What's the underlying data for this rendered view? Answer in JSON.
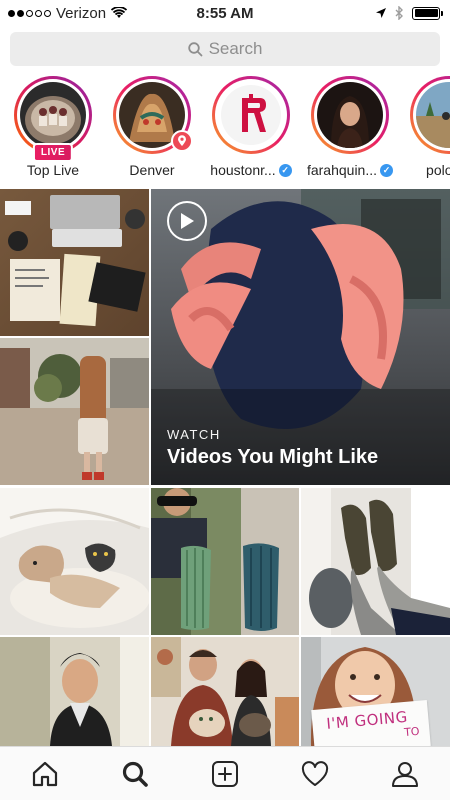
{
  "status_bar": {
    "carrier": "Verizon",
    "time": "8:55 AM",
    "signal_filled": 2,
    "signal_total": 5
  },
  "search": {
    "placeholder": "Search"
  },
  "stories": [
    {
      "name": "Top Live",
      "badge": "LIVE",
      "verified": false
    },
    {
      "name": "Denver",
      "badge": "location",
      "verified": false
    },
    {
      "name": "houstonr...",
      "verified": true
    },
    {
      "name": "farahquin...",
      "verified": true
    },
    {
      "name": "polo_m",
      "verified": false
    }
  ],
  "featured_video": {
    "watch_label": "WATCH",
    "title": "Videos You Might Like"
  },
  "grid_tiles": [
    "desk-workspace",
    "girl-with-flowers",
    "dog-and-cat",
    "man-with-yarn",
    "socks-and-shoes",
    "young-man-portrait",
    "family-with-cats",
    "woman-with-sign"
  ],
  "sign_text": {
    "line1": "I'M GOING",
    "line2": "TO"
  },
  "bottom_nav": [
    {
      "id": "home",
      "icon": "home-icon"
    },
    {
      "id": "search",
      "icon": "search-icon",
      "active": true
    },
    {
      "id": "new-post",
      "icon": "plus-square-icon"
    },
    {
      "id": "activity",
      "icon": "heart-icon"
    },
    {
      "id": "profile",
      "icon": "person-icon"
    }
  ],
  "colors": {
    "ring_gradient_start": "#f9a825",
    "ring_gradient_end": "#9c27b0",
    "live_badge": "#e91e63",
    "verified": "#3897f0",
    "search_bg": "#ececec"
  }
}
